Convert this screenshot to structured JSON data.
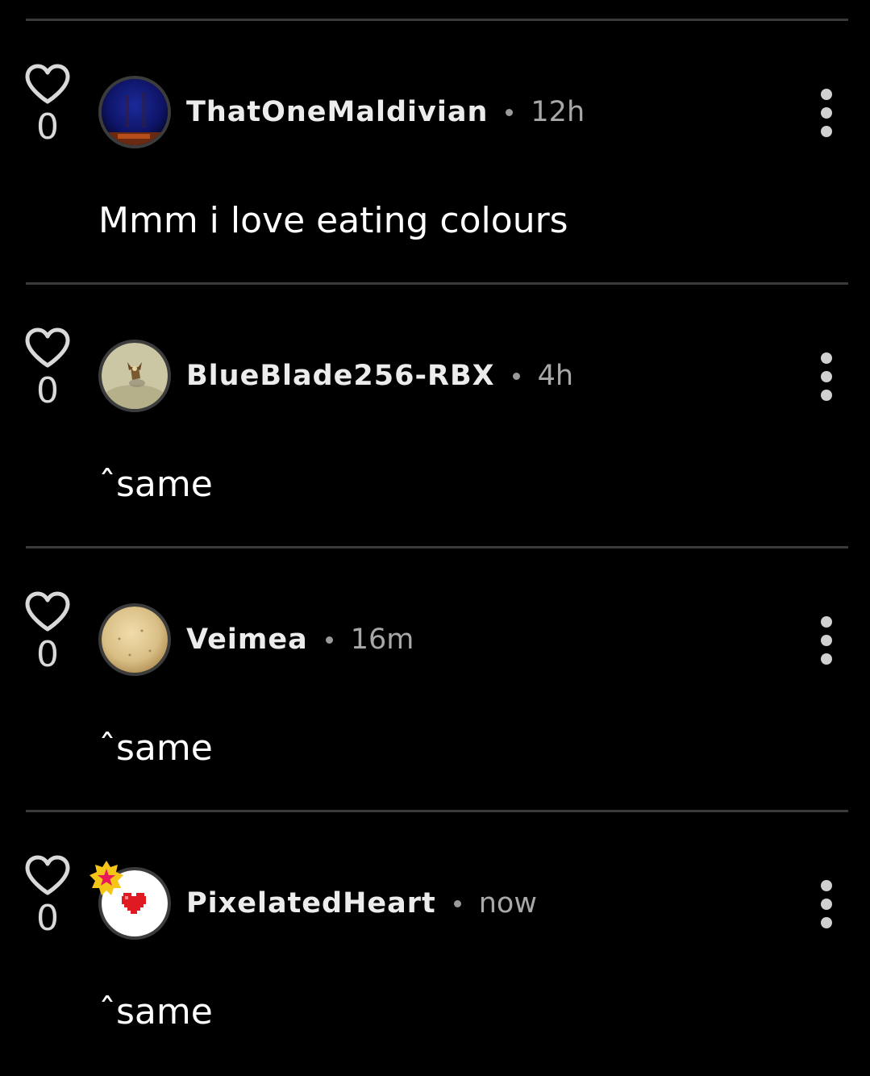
{
  "theme": {
    "background": "#000000",
    "divider": "#3a3a3a",
    "username_color": "#ececec",
    "meta_color": "#a8a8a8"
  },
  "comments": [
    {
      "like_count": "0",
      "username": "ThatOneMaldivian",
      "time": "12h",
      "text": "Mmm i love eating colours",
      "avatar": "dark-blue-night-avatar"
    },
    {
      "like_count": "0",
      "username": "BlueBlade256-RBX",
      "time": "4h",
      "text": "ˆsame",
      "avatar": "sandy-character-avatar"
    },
    {
      "like_count": "0",
      "username": "Veimea",
      "time": "16m",
      "text": "ˆsame",
      "avatar": "beige-sphere-avatar"
    },
    {
      "like_count": "0",
      "username": "PixelatedHeart",
      "time": "now",
      "text": "ˆsame",
      "avatar": "pixel-heart-avatar",
      "badge": "star-badge-icon"
    }
  ]
}
